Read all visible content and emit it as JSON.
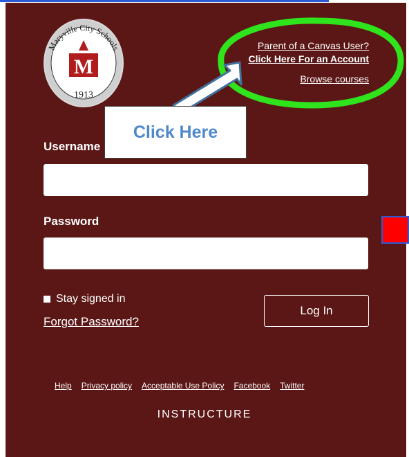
{
  "logo": {
    "text_top": "Maryville City Schools",
    "letter": "M",
    "year": "1913"
  },
  "top_links": {
    "parent_label": "Parent of a Canvas User?",
    "create_account": "Click Here For an Account",
    "browse": "Browse courses"
  },
  "callout": {
    "text": "Click Here"
  },
  "form": {
    "username_label": "Username",
    "password_label": "Password",
    "stay_signed": "Stay signed in",
    "forgot": "Forgot Password?",
    "login_button": "Log In"
  },
  "footer": {
    "links": [
      "Help",
      "Privacy policy",
      "Acceptable Use Policy",
      "Facebook",
      "Twitter"
    ],
    "brand": "INSTRUCTURE"
  },
  "colors": {
    "panel": "#5b1716",
    "highlight_green": "#2fe31d",
    "callout_text": "#4f89c9",
    "red_square": "#ff0000"
  }
}
